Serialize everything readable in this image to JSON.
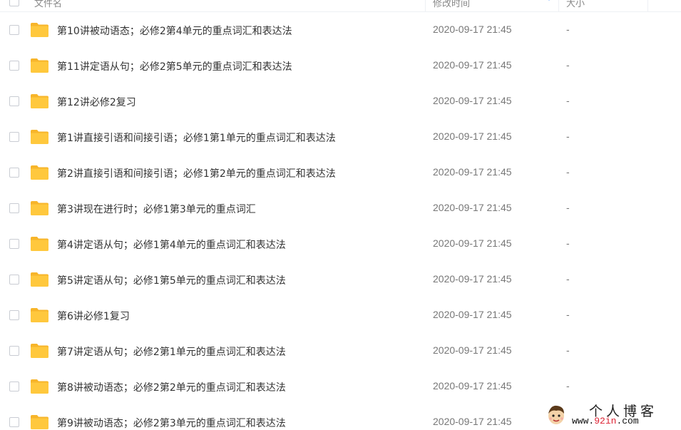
{
  "header": {
    "name_label": "文件名",
    "time_label": "修改时间",
    "size_label": "大小"
  },
  "files": [
    {
      "name": "第10讲被动语态；必修2第4单元的重点词汇和表达法",
      "time": "2020-09-17 21:45",
      "size": "-"
    },
    {
      "name": "第11讲定语从句；必修2第5单元的重点词汇和表达法",
      "time": "2020-09-17 21:45",
      "size": "-"
    },
    {
      "name": "第12讲必修2复习",
      "time": "2020-09-17 21:45",
      "size": "-"
    },
    {
      "name": "第1讲直接引语和间接引语；必修1第1单元的重点词汇和表达法",
      "time": "2020-09-17 21:45",
      "size": "-"
    },
    {
      "name": "第2讲直接引语和间接引语；必修1第2单元的重点词汇和表达法",
      "time": "2020-09-17 21:45",
      "size": "-"
    },
    {
      "name": "第3讲现在进行时；必修1第3单元的重点词汇",
      "time": "2020-09-17 21:45",
      "size": "-"
    },
    {
      "name": "第4讲定语从句；必修1第4单元的重点词汇和表达法",
      "time": "2020-09-17 21:45",
      "size": "-"
    },
    {
      "name": "第5讲定语从句；必修1第5单元的重点词汇和表达法",
      "time": "2020-09-17 21:45",
      "size": "-"
    },
    {
      "name": "第6讲必修1复习",
      "time": "2020-09-17 21:45",
      "size": "-"
    },
    {
      "name": "第7讲定语从句；必修2第1单元的重点词汇和表达法",
      "time": "2020-09-17 21:45",
      "size": "-"
    },
    {
      "name": "第8讲被动语态；必修2第2单元的重点词汇和表达法",
      "time": "2020-09-17 21:45",
      "size": "-"
    },
    {
      "name": "第9讲被动语态；必修2第3单元的重点词汇和表达法",
      "time": "2020-09-17 21:45",
      "size": "-"
    }
  ],
  "watermark": {
    "title": "个人博客",
    "url_prefix": "www.",
    "url_highlight": "92in",
    "url_suffix": ".com"
  },
  "colors": {
    "folder": "#ffc83d",
    "folder_tab": "#f7b52a",
    "accent": "#6aa6ff",
    "url_highlight": "#dd2233"
  }
}
